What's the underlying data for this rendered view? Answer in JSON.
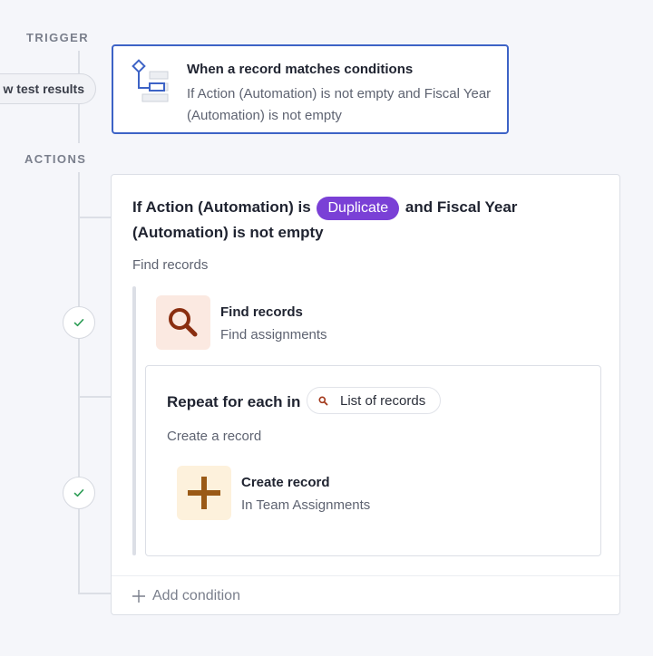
{
  "labels": {
    "trigger": "TRIGGER",
    "actions": "ACTIONS"
  },
  "test_results_button": "w test results",
  "trigger": {
    "icon": "condition-flow-icon",
    "title": "When a record matches conditions",
    "description": "If Action (Automation) is not empty and Fiscal Year (Automation) is not empty"
  },
  "condition": {
    "prefix": "If Action (Automation) is",
    "chip": "Duplicate",
    "suffix": "and Fiscal Year (Automation) is not empty",
    "branch_label": "Find records"
  },
  "find_step": {
    "icon": "magnifier-icon",
    "title": "Find records",
    "subtitle": "Find assignments"
  },
  "repeat": {
    "title": "Repeat for each in",
    "list_label": "List of records",
    "sub_label": "Create a record"
  },
  "create_step": {
    "icon": "plus-icon",
    "title": "Create record",
    "subtitle": "In Team Assignments"
  },
  "add_condition": "Add condition",
  "colors": {
    "accent": "#3d63c6",
    "chip": "#7a40d6",
    "find_icon_bg": "#fbe9e1",
    "find_icon": "#8a2e10",
    "create_icon_bg": "#fdf1dc",
    "create_icon": "#9a5a16"
  }
}
